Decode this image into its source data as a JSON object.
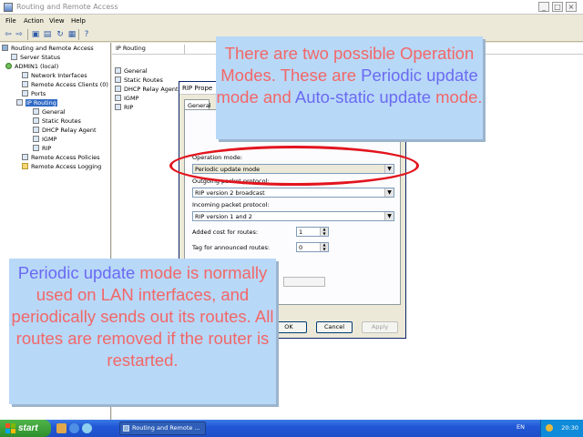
{
  "window": {
    "title": "Routing and Remote Access",
    "controls": {
      "minimize": "_",
      "maximize": "□",
      "close": "×"
    }
  },
  "menubar": {
    "items": [
      "File",
      "Action",
      "View",
      "Help"
    ]
  },
  "toolbar": {
    "buttons": [
      "back-icon",
      "forward-icon",
      "up-icon",
      "show-tree-icon",
      "refresh-icon",
      "export-icon",
      "help-icon"
    ]
  },
  "tree": {
    "items": [
      {
        "label": "Routing and Remote Access",
        "icon": "server-icon"
      },
      {
        "label": "Server Status",
        "icon": "status-icon"
      },
      {
        "label": "ADMIN1 (local)",
        "icon": "server-up-icon"
      },
      {
        "label": "Network Interfaces",
        "icon": "interfaces-icon"
      },
      {
        "label": "Remote Access Clients (0)",
        "icon": "clients-icon"
      },
      {
        "label": "Ports",
        "icon": "ports-icon"
      },
      {
        "label": "IP Routing",
        "icon": "routing-icon"
      },
      {
        "label": "General",
        "icon": "routing-icon"
      },
      {
        "label": "Static Routes",
        "icon": "routing-icon"
      },
      {
        "label": "DHCP Relay Agent",
        "icon": "routing-icon"
      },
      {
        "label": "IGMP",
        "icon": "routing-icon"
      },
      {
        "label": "RIP",
        "icon": "routing-icon"
      },
      {
        "label": "Remote Access Policies",
        "icon": "policies-icon"
      },
      {
        "label": "Remote Access Logging",
        "icon": "folder-icon"
      }
    ]
  },
  "list": {
    "header": "IP Routing",
    "items": [
      "General",
      "Static Routes",
      "DHCP Relay Agent",
      "IGMP",
      "RIP"
    ]
  },
  "dialog": {
    "title": "RIP Prope",
    "tab": "General",
    "operation_mode_label": "Operation mode:",
    "operation_mode_value": "Periodic update mode",
    "outgoing_label": "Outgoing packet protocol:",
    "outgoing_value": "RIP version 2 broadcast",
    "incoming_label": "Incoming packet protocol:",
    "incoming_value": "RIP version 1 and 2",
    "added_cost_label": "Added cost for routes:",
    "added_cost_value": "1",
    "tag_label": "Tag for announced routes:",
    "tag_value": "0",
    "buttons": {
      "ok": "OK",
      "cancel": "Cancel",
      "apply": "Apply"
    }
  },
  "callout_top": {
    "parts": [
      {
        "text": "There are two possible Operation Modes. These are ",
        "color": "red"
      },
      {
        "text": "Periodic update",
        "color": "blue"
      },
      {
        "text": " mode and ",
        "color": "red"
      },
      {
        "text": "Auto-static update",
        "color": "blue"
      },
      {
        "text": " mode.",
        "color": "red"
      }
    ]
  },
  "callout_bottom": {
    "parts": [
      {
        "text": "Periodic update",
        "color": "blue"
      },
      {
        "text": " mode is normally used on LAN interfaces, and periodically sends out its routes. All routes are removed if the router is restarted.",
        "color": "red"
      }
    ]
  },
  "taskbar": {
    "start_label": "start",
    "task_label": "Routing and Remote ...",
    "language": "EN",
    "clock": "20:30"
  },
  "colors": {
    "callout_bg": "#b8d8f8",
    "callout_red": "#f26767",
    "callout_blue": "#6a6af2",
    "highlight_ellipse": "#e2141e",
    "taskbar_blue": "#2157d6",
    "start_green": "#3a9f37"
  }
}
